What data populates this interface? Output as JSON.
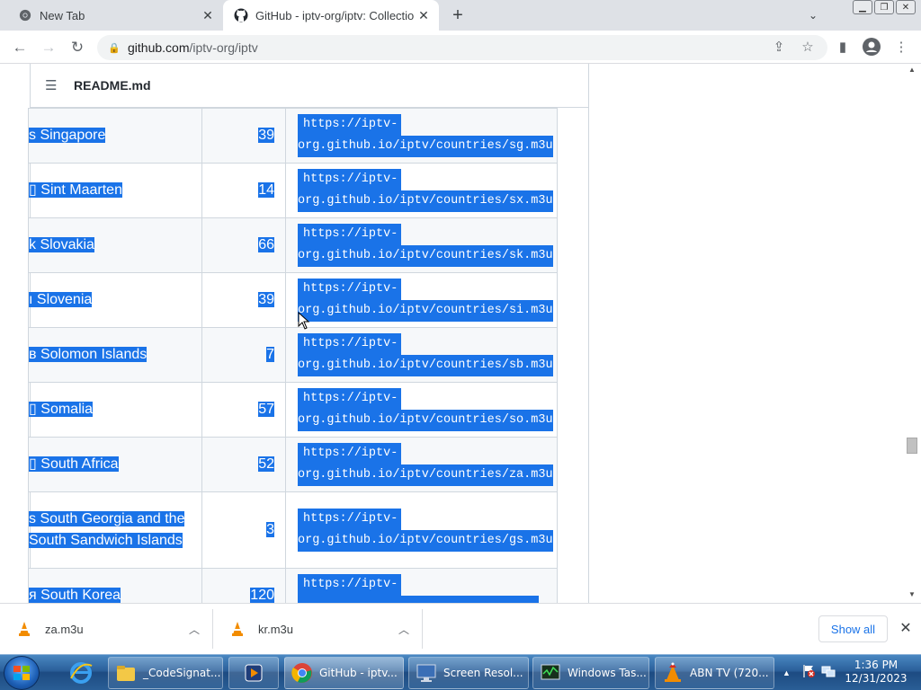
{
  "browser": {
    "tabs": [
      {
        "label": "New Tab",
        "active": false,
        "icon": "chrome-icon"
      },
      {
        "label": "GitHub - iptv-org/iptv: Collectior",
        "active": true,
        "icon": "github-icon"
      }
    ],
    "new_tab_symbol": "+",
    "url_host": "github.com",
    "url_path": "/iptv-org/iptv"
  },
  "readme": {
    "filename": "README.md"
  },
  "table": {
    "rows": [
      {
        "flag": "🇸🇬",
        "prefix": "s",
        "country": "Singapore",
        "count": "39",
        "url1": "https://iptv-",
        "url2": "org.github.io/iptv/countries/sg.m3u"
      },
      {
        "flag": "",
        "prefix": "▯",
        "country": "Sint Maarten",
        "count": "14",
        "url1": "https://iptv-",
        "url2": "org.github.io/iptv/countries/sx.m3u"
      },
      {
        "flag": "",
        "prefix": "k",
        "country": "Slovakia",
        "count": "66",
        "url1": "https://iptv-",
        "url2": "org.github.io/iptv/countries/sk.m3u"
      },
      {
        "flag": "",
        "prefix": "ı",
        "country": "Slovenia",
        "count": "39",
        "url1": "https://iptv-",
        "url2": "org.github.io/iptv/countries/si.m3u"
      },
      {
        "flag": "",
        "prefix": "в",
        "country": "Solomon Islands",
        "count": "7",
        "url1": "https://iptv-",
        "url2": "org.github.io/iptv/countries/sb.m3u"
      },
      {
        "flag": "",
        "prefix": "▯",
        "country": "Somalia",
        "count": "57",
        "url1": "https://iptv-",
        "url2": "org.github.io/iptv/countries/so.m3u"
      },
      {
        "flag": "",
        "prefix": "▯",
        "country": "South Africa",
        "count": "52",
        "url1": "https://iptv-",
        "url2": "org.github.io/iptv/countries/za.m3u"
      },
      {
        "flag": "",
        "prefix": "s",
        "country": "South Georgia and the South Sandwich Islands",
        "count": "3",
        "url1": "https://iptv-",
        "url2": "org.github.io/iptv/countries/gs.m3u"
      },
      {
        "flag": "",
        "prefix": "я",
        "country": "South Korea",
        "count": "120",
        "url1": "https://iptv-",
        "url2": ""
      }
    ]
  },
  "downloads": {
    "items": [
      {
        "name": "za.m3u"
      },
      {
        "name": "kr.m3u"
      }
    ],
    "show_all": "Show all"
  },
  "taskbar": {
    "tasks": [
      {
        "label": "_CodeSignat...",
        "icon": "folder-icon"
      },
      {
        "label": "",
        "icon": "media-player-icon"
      },
      {
        "label": "GitHub - iptv...",
        "icon": "chrome-icon"
      },
      {
        "label": "Screen Resol...",
        "icon": "display-icon"
      },
      {
        "label": "Windows Tas...",
        "icon": "task-manager-icon"
      },
      {
        "label": "ABN TV (720...",
        "icon": "vlc-icon"
      }
    ],
    "time": "1:36 PM",
    "date": "12/31/2023"
  }
}
